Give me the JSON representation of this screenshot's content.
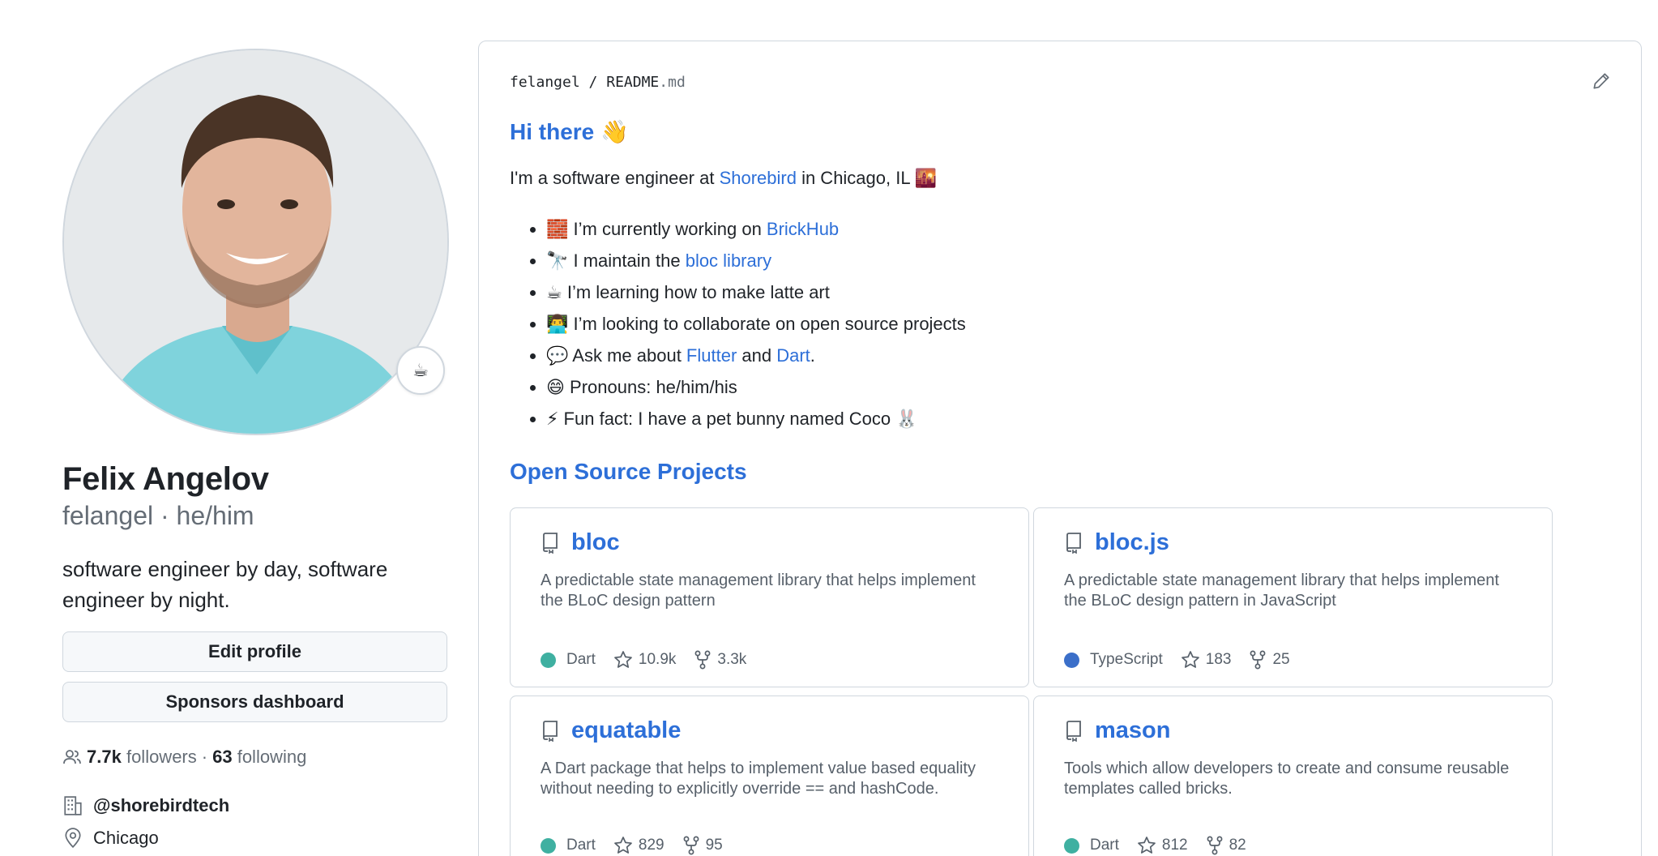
{
  "profile": {
    "name": "Felix Angelov",
    "login_line": "felangel · he/him",
    "status_emoji": "☕",
    "bio": "software engineer by day, software engineer by night.",
    "edit_profile": "Edit profile",
    "sponsors_dashboard": "Sponsors dashboard",
    "followers_count": "7.7k",
    "followers_label": "followers",
    "separator": "·",
    "following_count": "63",
    "following_label": "following",
    "organization": "@shorebirdtech",
    "location": "Chicago"
  },
  "readme": {
    "owner": "felangel",
    "slash": "/",
    "file": "README",
    "ext": ".md",
    "greeting": "Hi there 👋",
    "intro_pre": "I'm a software engineer at ",
    "intro_link": "Shorebird",
    "intro_post": " in Chicago, IL 🌇",
    "facts": [
      {
        "pre": "🧱 I’m currently working on ",
        "link": "BrickHub",
        "mid": "",
        "link2": "",
        "post": ""
      },
      {
        "pre": "🔭 I maintain the ",
        "link": "bloc library",
        "mid": "",
        "link2": "",
        "post": ""
      },
      {
        "pre": "☕ I’m learning how to make latte art",
        "link": "",
        "mid": "",
        "link2": "",
        "post": ""
      },
      {
        "pre": "👨‍💻 I’m looking to collaborate on open source projects",
        "link": "",
        "mid": "",
        "link2": "",
        "post": ""
      },
      {
        "pre": "💬 Ask me about ",
        "link": "Flutter",
        "mid": " and ",
        "link2": "Dart",
        "post": "."
      },
      {
        "pre": "😄 Pronouns: he/him/his",
        "link": "",
        "mid": "",
        "link2": "",
        "post": ""
      },
      {
        "pre": "⚡ Fun fact: I have a pet bunny named Coco 🐰",
        "link": "",
        "mid": "",
        "link2": "",
        "post": ""
      }
    ],
    "projects_heading": "Open Source Projects",
    "projects": [
      {
        "name": "bloc",
        "desc": "A predictable state management library that helps implement the BLoC design pattern",
        "lang": "Dart",
        "lang_color": "#3fb0a1",
        "stars": "10.9k",
        "forks": "3.3k"
      },
      {
        "name": "bloc.js",
        "desc": "A predictable state management library that helps implement the BLoC design pattern in JavaScript",
        "lang": "TypeScript",
        "lang_color": "#3b6fc9",
        "stars": "183",
        "forks": "25"
      },
      {
        "name": "equatable",
        "desc": "A Dart package that helps to implement value based equality without needing to explicitly override == and hashCode.",
        "lang": "Dart",
        "lang_color": "#3fb0a1",
        "stars": "829",
        "forks": "95"
      },
      {
        "name": "mason",
        "desc": "Tools which allow developers to create and consume reusable templates called bricks.",
        "lang": "Dart",
        "lang_color": "#3fb0a1",
        "stars": "812",
        "forks": "82"
      }
    ]
  }
}
